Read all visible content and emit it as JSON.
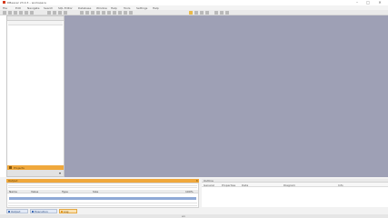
{
  "window": {
    "title": "DBeaver 23.0.3 – workspace",
    "minimize": "–",
    "maximize": "□",
    "close": "✕"
  },
  "menu": [
    "File",
    "Edit",
    "Navigate",
    "Search",
    "SQL Editor",
    "Database",
    "Window",
    "Help",
    "Tools",
    "Settings",
    "Help"
  ],
  "left_panel": {
    "header": "Database Navigator",
    "search_placeholder": "",
    "footer_label": "Projects",
    "collapse_arrow": "▾"
  },
  "output_panel": {
    "title": "Output",
    "close": "✕",
    "columns": [
      "Name",
      "Value",
      "Type",
      "Size"
    ],
    "progress_fraction": 1.0,
    "progress_label": "100%"
  },
  "right_panel": {
    "title": "Outline",
    "tabs": [
      "General",
      "Properties",
      "Data",
      "Diagram",
      "Info"
    ]
  },
  "status_tabs": [
    {
      "label": "Output",
      "active": false
    },
    {
      "label": "Execution",
      "active": false
    },
    {
      "label": "Log",
      "active": true
    }
  ],
  "status": {
    "text": "en"
  },
  "colors": {
    "accent_orange": "#f0a83c",
    "workspace": "#9ea0b5"
  }
}
